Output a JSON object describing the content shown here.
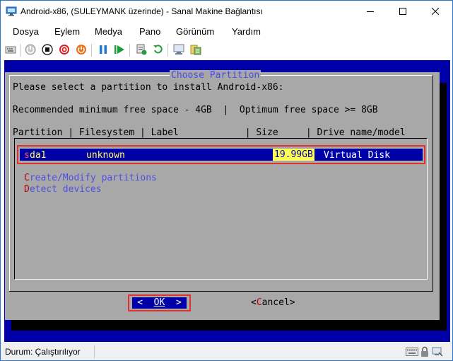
{
  "window": {
    "title": "Android-x86, (SULEYMANK üzerinde) - Sanal Makine Bağlantısı"
  },
  "menu": {
    "items": [
      "Dosya",
      "Eylem",
      "Medya",
      "Pano",
      "Görünüm",
      "Yardım"
    ]
  },
  "toolbar": {
    "icons": [
      "ctrl-alt-del-icon",
      "start-icon",
      "turn-off-icon",
      "shutdown-icon",
      "save-state-icon",
      "pause-icon",
      "resume-icon",
      "checkpoint-icon",
      "revert-icon",
      "enhanced-session-icon",
      "share-icon"
    ]
  },
  "installer": {
    "title": "Choose Partition",
    "prompt": "Please select a partition to install Android-x86:",
    "space_info": "Recommended minimum free space - 4GB  |  Optimum free space >= 8GB",
    "header": "Partition | Filesystem | Label            | Size     | Drive name/model",
    "partition": {
      "first_char": "s",
      "name_rest": "da1",
      "filesystem": "unknown",
      "size": "19.99GB",
      "drive": "Virtual Disk"
    },
    "create_hot": "C",
    "create_rest": "reate/Modify partitions",
    "detect_hot": "D",
    "detect_rest": "etect devices",
    "ok_left": "<  ",
    "ok_label": "OK",
    "ok_right": "  >",
    "cancel_left": "<",
    "cancel_hot": "C",
    "cancel_rest": "ancel>"
  },
  "status": {
    "text": "Durum: Çalıştırılıyor"
  },
  "colors": {
    "vm_background": "#0000a8",
    "dialog": "#a8a8a8",
    "highlight_border": "#e03030"
  }
}
